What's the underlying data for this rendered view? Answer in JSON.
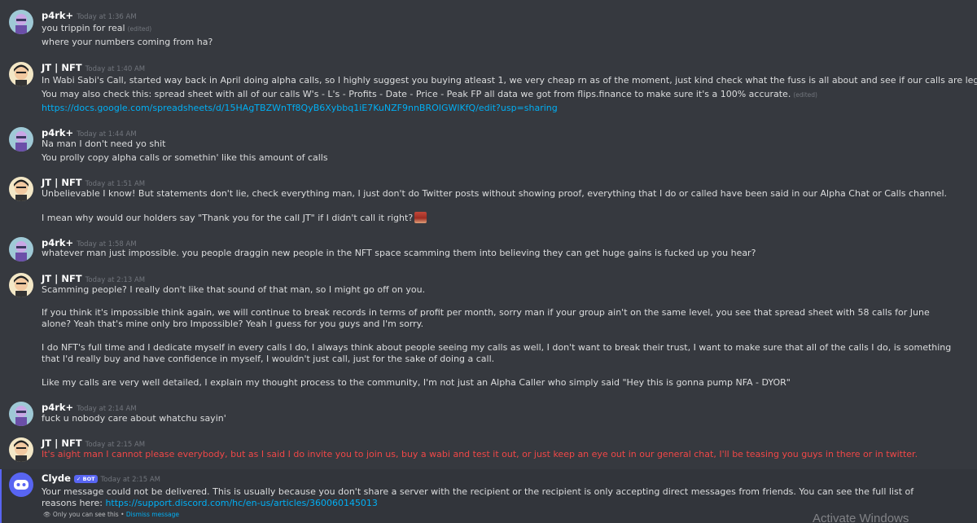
{
  "messages": [
    {
      "author": "p4rk+",
      "timestamp": "Today at 1:36 AM",
      "avatar": "p4rk-avatar",
      "lines": [
        {
          "text": "you trippin for real",
          "edited": "(edited)"
        },
        {
          "text": "where your numbers coming from ha?"
        }
      ]
    },
    {
      "author": "JT | NFT",
      "timestamp": "Today at 1:40 AM",
      "avatar": "jt-avatar",
      "lines": [
        {
          "text": "In Wabi Sabi's Call, started way back in April doing alpha calls, so I highly suggest you buying atleast 1, we very cheap rn as of the moment, just kind check what the fuss is all about and see if our calls are legit my guy."
        },
        {
          "text": "You may also check this: spread sheet with all of our calls W's - L's - Profits - Date - Price - Peak FP all data we got from flips.finance to make sure it's a 100% accurate.",
          "edited": "(edited)"
        },
        {
          "link": "https://docs.google.com/spreadsheets/d/15HAgTBZWnTf8QyB6Xybbq1iE7KuNZF9nnBROIGWlKfQ/edit?usp=sharing"
        }
      ]
    },
    {
      "author": "p4rk+",
      "timestamp": "Today at 1:44 AM",
      "avatar": "p4rk-avatar",
      "lines": [
        {
          "text": "Na man I don't need yo shit"
        },
        {
          "text": "You prolly copy alpha calls or somethin' like this amount of calls"
        }
      ]
    },
    {
      "author": "JT | NFT",
      "timestamp": "Today at 1:51 AM",
      "avatar": "jt-avatar",
      "lines": [
        {
          "text": "Unbelievable I know! But statements don't lie, check everything man, I just don't do Twitter posts without showing proof, everything that I do or called have been said in our Alpha Chat or Calls channel."
        },
        {
          "text": "I mean why would our holders say \"Thank you for the call JT\" if I didn't call it right?",
          "emoji": "face-emoji"
        }
      ]
    },
    {
      "author": "p4rk+",
      "timestamp": "Today at 1:58 AM",
      "avatar": "p4rk-avatar",
      "lines": [
        {
          "text": "whatever man just impossible. you people draggin new people in the NFT space scamming them into believing they can get huge gains is fucked up you hear?"
        }
      ]
    },
    {
      "author": "JT | NFT",
      "timestamp": "Today at 2:13 AM",
      "avatar": "jt-avatar",
      "lines": [
        {
          "text": "Scamming people? I really don't like that sound of that man, so I might go off on you."
        },
        {
          "text": "If you think it's impossible think again, we will continue to break records in terms of profit per month, sorry man if your group ain't on the same level, you see that spread sheet with 58 calls for June alone? Yeah that's mine only bro Impossible? Yeah I guess for you guys and I'm sorry."
        },
        {
          "text": "I do NFT's full time and I dedicate myself in every calls I do, I always think about people seeing my calls as well, I don't want to break their trust, I want to make sure that all of the calls I do, is something that I'd really buy and have confidence in myself, I wouldn't just call, just for the sake of doing a call."
        },
        {
          "text": "Like my calls are very well detailed, I explain my thought process to the community, I'm not just an Alpha Caller who simply said \"Hey this is gonna pump NFA - DYOR\""
        }
      ]
    },
    {
      "author": "p4rk+",
      "timestamp": "Today at 2:14 AM",
      "avatar": "p4rk-avatar",
      "lines": [
        {
          "text": "fuck u nobody care about whatchu sayin'"
        }
      ]
    },
    {
      "author": "JT | NFT",
      "timestamp": "Today at 2:15 AM",
      "avatar": "jt-avatar",
      "lines": [
        {
          "text": "It's aight man I cannot please everybody, but as I said I do invite you to join us, buy a wabi and test it out, or just keep an eye out in our general chat, I'll be teasing you guys in there or in twitter.",
          "color": "#f04747"
        }
      ]
    },
    {
      "author": "Clyde",
      "badge": "✓ BOT",
      "timestamp": "Today at 2:15 AM",
      "avatar": "clyde-avatar",
      "lines": [
        {
          "text": "Your message could not be delivered. This is usually because you don't share a server with the recipient or the recipient is only accepting direct messages from friends. You can see the full list of reasons here: ",
          "link": "https://support.discord.com/hc/en-us/articles/360060145013"
        }
      ]
    }
  ],
  "clyde_notice": {
    "text": "Only you can see this • ",
    "dismiss": "Dismiss message",
    "icon": "eye-icon"
  },
  "watermark": "Activate Windows",
  "colors": {
    "background": "#36393f",
    "link": "#00aff4",
    "error_text": "#f04747",
    "bot_badge": "#5865f2"
  }
}
